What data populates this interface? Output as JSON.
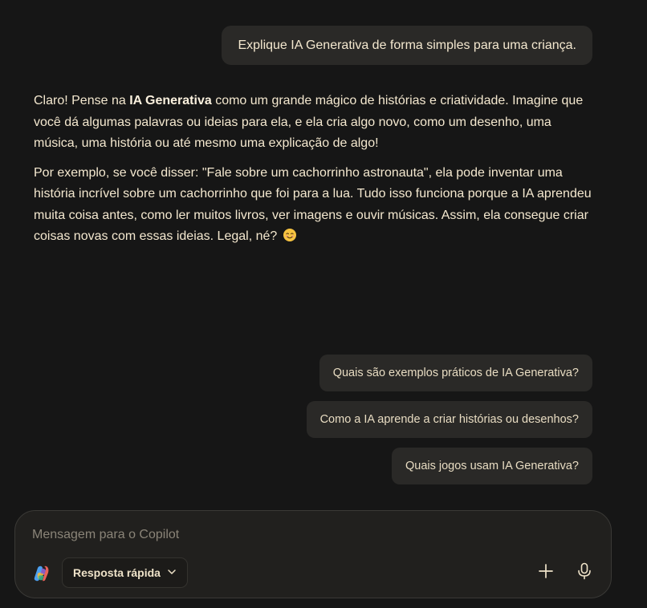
{
  "conversation": {
    "user_message": "Explique IA Generativa de forma simples para uma criança.",
    "assistant": {
      "p1_before": "Claro! Pense na ",
      "p1_bold": "IA Generativa",
      "p1_after": " como um grande mágico de histórias e criatividade. Imagine que você dá algumas palavras ou ideias para ela, e ela cria algo novo, como um desenho, uma música, uma história ou até mesmo uma explicação de algo!",
      "p2": "Por exemplo, se você disser: \"Fale sobre um cachorrinho astronauta\", ela pode inventar uma história incrível sobre um cachorrinho que foi para a lua. Tudo isso funciona porque a IA aprendeu muita coisa antes, como ler muitos livros, ver imagens e ouvir músicas. Assim, ela consegue criar coisas novas com essas ideias. Legal, né?",
      "emoji_icon": "smiling-face-emoji"
    }
  },
  "suggestions": [
    {
      "label": "Quais são exemplos práticos de IA Generativa?"
    },
    {
      "label": "Como a IA aprende a criar histórias ou desenhos?"
    },
    {
      "label": "Quais jogos usam IA Generativa?"
    }
  ],
  "composer": {
    "placeholder": "Mensagem para o Copilot",
    "value": "",
    "mode_label": "Resposta rápida",
    "icons": {
      "logo": "copilot-logo-icon",
      "mode": "chevron-down-icon",
      "add": "plus-icon",
      "voice": "microphone-icon"
    }
  },
  "colors": {
    "background": "#161616",
    "bubble": "#2a2927",
    "text": "#f4e8cf",
    "composer_bg": "#21201e"
  }
}
